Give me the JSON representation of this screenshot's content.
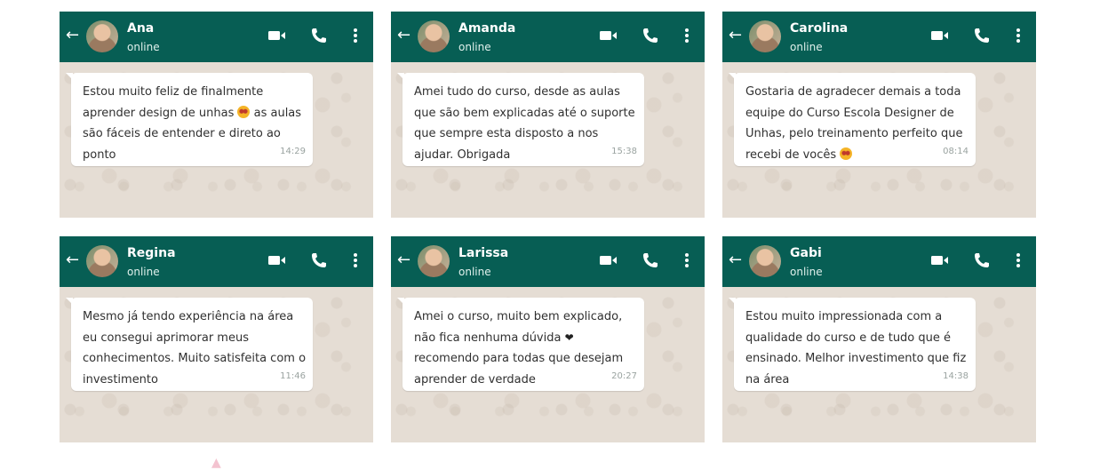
{
  "chats": [
    {
      "name": "Ana",
      "status": "online",
      "pre": "Estou muito feliz de finalmente aprender design de unhas ",
      "emoji": "heart-eyes-emoji",
      "post": " as aulas são fáceis de entender e direto ao ponto",
      "time": "14:29"
    },
    {
      "name": "Amanda",
      "status": "online",
      "pre": "Amei tudo do curso, desde as aulas que são bem explicadas até o suporte que sempre esta disposto a nos ajudar. Obrigada",
      "emoji": "",
      "post": "",
      "time": "15:38"
    },
    {
      "name": "Carolina",
      "status": "online",
      "pre": "Gostaria de agradecer demais a toda equipe do Curso Escola Designer de Unhas, pelo treinamento perfeito que recebi de vocês ",
      "emoji": "heart-eyes-emoji",
      "post": "",
      "time": "08:14"
    },
    {
      "name": "Regina",
      "status": "online",
      "pre": "Mesmo já tendo experiência na área eu consegui aprimorar meus conhecimentos. Muito satisfeita com o investimento",
      "emoji": "",
      "post": "",
      "time": "11:46"
    },
    {
      "name": "Larissa",
      "status": "online",
      "pre": "Amei o curso, muito bem explicado, não fica nenhuma dúvida ",
      "emoji": "black-heart",
      "post": " recomendo para todas que desejam aprender de verdade",
      "time": "20:27"
    },
    {
      "name": "Gabi",
      "status": "online",
      "pre": "Estou muito impressionada com a qualidade do curso e de tudo que é ensinado. Melhor investimento que fiz na área",
      "emoji": "",
      "post": "",
      "time": "14:38"
    }
  ],
  "colors": {
    "header": "#075e54",
    "wallpaper": "#e5ddd4",
    "bubble": "#ffffff"
  },
  "icons": {
    "back": "arrow-left-icon",
    "video": "video-call-icon",
    "call": "phone-icon",
    "menu": "more-vert-icon"
  }
}
